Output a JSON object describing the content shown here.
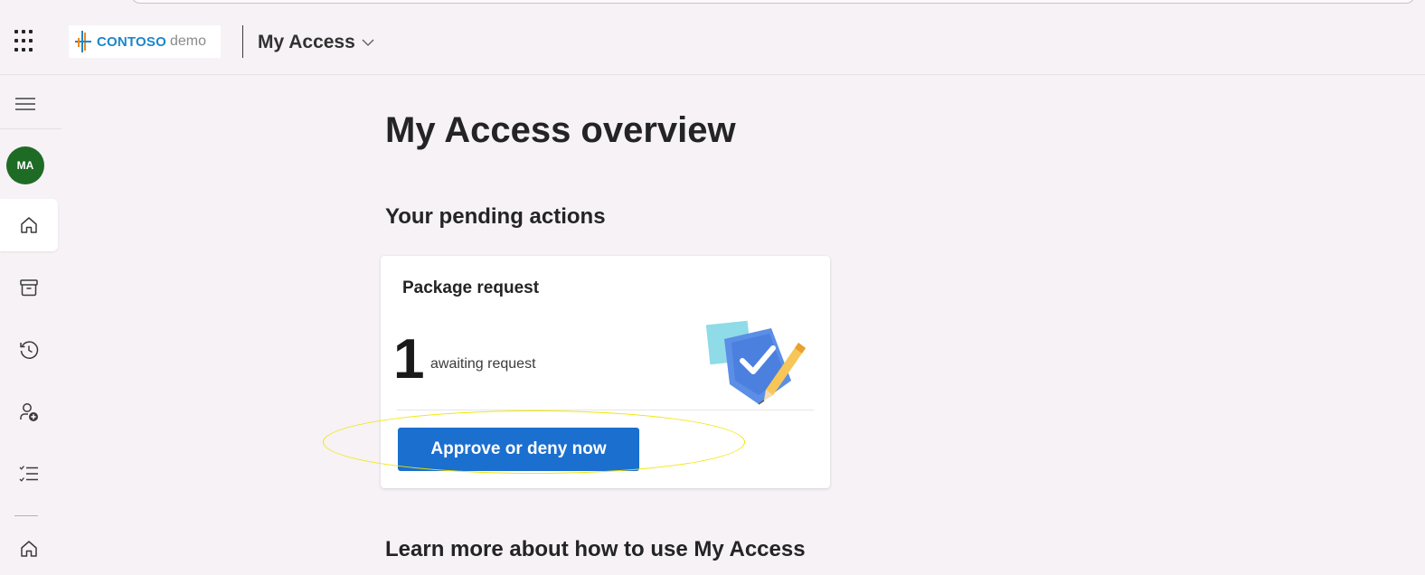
{
  "header": {
    "logo_brand": "CONTOSO",
    "logo_suffix": "demo",
    "app_title": "My Access",
    "app_title_chevron": "chevron-down-icon"
  },
  "sidebar": {
    "menu_icon": "hamburger-icon",
    "avatar_initials": "MA",
    "avatar_color": "#1e6b25",
    "items": [
      {
        "icon": "home-icon",
        "active": true
      },
      {
        "icon": "archive-box-icon",
        "active": false
      },
      {
        "icon": "history-icon",
        "active": false
      },
      {
        "icon": "person-add-icon",
        "active": false
      },
      {
        "icon": "task-list-icon",
        "active": false
      },
      {
        "icon": "home-icon",
        "active": false
      }
    ]
  },
  "main": {
    "page_title": "My Access overview",
    "pending_title": "Your pending actions",
    "card": {
      "title": "Package request",
      "count": "1",
      "count_label": "awaiting request",
      "illustration": "shield-check-pencil-icon",
      "button_label": "Approve or deny now",
      "button_color": "#1b6fce"
    },
    "learn_title": "Learn more about how to use My Access"
  },
  "annotation": {
    "highlight_color": "#f2e600"
  }
}
